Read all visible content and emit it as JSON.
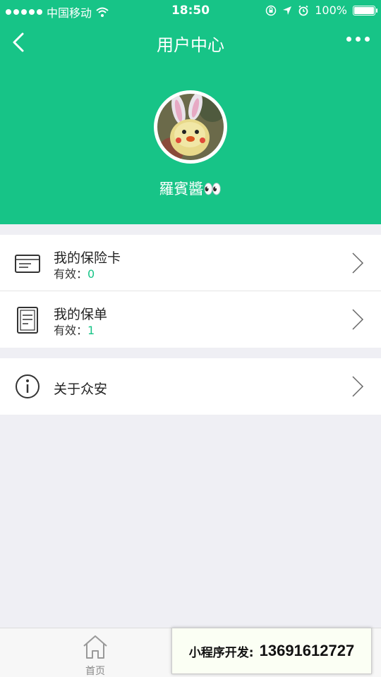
{
  "status_bar": {
    "carrier": "中国移动",
    "time": "18:50",
    "battery": "100%",
    "battery_level": 1.0,
    "icons": [
      "signal-dots-icon",
      "wifi-icon",
      "rotation-lock-icon",
      "location-icon",
      "alarm-icon",
      "battery-icon"
    ]
  },
  "nav": {
    "title": "用户中心",
    "back_icon": "back-chevron-icon",
    "more_icon": "more-dots-icon"
  },
  "profile": {
    "username": "羅賓醬👀"
  },
  "menu": {
    "insurance_card": {
      "title": "我的保险卡",
      "sub_label": "有效：",
      "sub_value": "0",
      "icon": "card-icon"
    },
    "policy": {
      "title": "我的保单",
      "sub_label": "有效：",
      "sub_value": "1",
      "icon": "document-icon"
    },
    "about": {
      "title": "关于众安",
      "icon": "info-icon"
    }
  },
  "tabbar": {
    "home_label": "首页",
    "home_icon": "home-icon"
  },
  "promo": {
    "label": "小程序开发:",
    "phone": "13691612727"
  },
  "colors": {
    "brand": "#17c487",
    "background": "#efeff4"
  }
}
